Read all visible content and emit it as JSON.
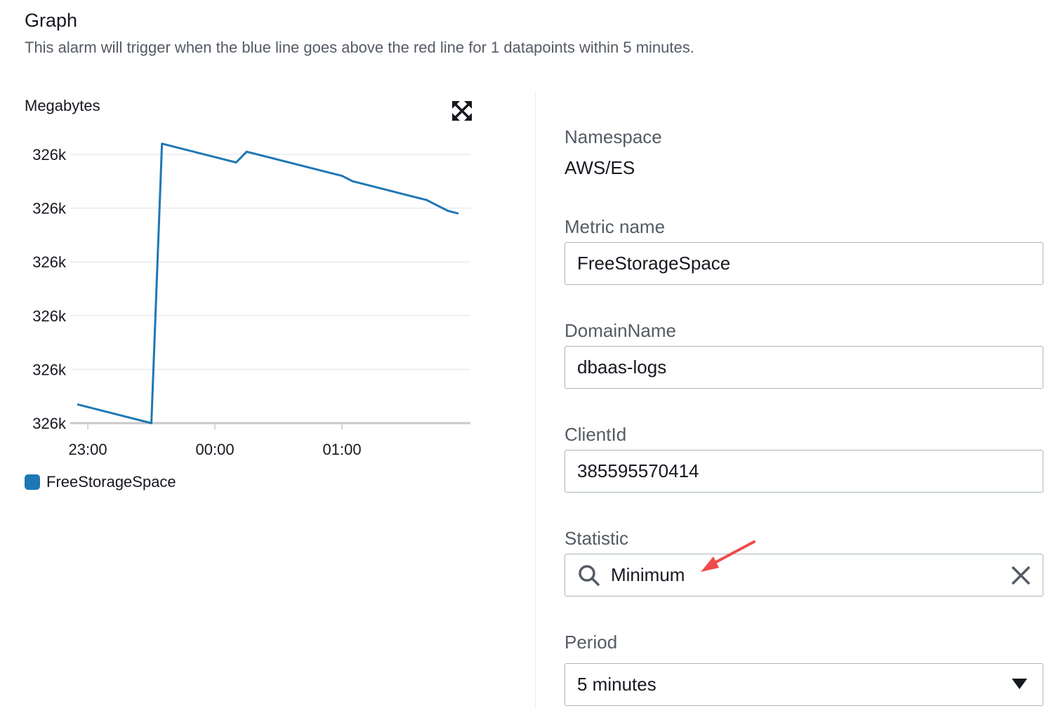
{
  "header": {
    "title": "Graph",
    "description": "This alarm will trigger when the blue line goes above the red line for 1 datapoints within 5 minutes."
  },
  "chart": {
    "unit_label": "Megabytes",
    "expand_icon": "expand-icon",
    "legend_label": "FreeStorageSpace",
    "series_color": "#1f77b4"
  },
  "chart_data": {
    "type": "line",
    "ylabel": "Megabytes",
    "y_tick_labels": [
      "326k",
      "326k",
      "326k",
      "326k",
      "326k",
      "326k"
    ],
    "x_tick_labels": [
      "23:00",
      "00:00",
      "01:00"
    ],
    "x_ticks_minutes": [
      0,
      60,
      120
    ],
    "xlim_minutes": [
      -5,
      175
    ],
    "ylim_relative": [
      0,
      1
    ],
    "grid": true,
    "legend_position": "bottom-left",
    "series": [
      {
        "name": "FreeStorageSpace",
        "color": "#1f77b4",
        "x_minutes": [
          -5,
          30,
          35,
          65,
          70,
          75,
          115,
          120,
          125,
          130,
          155,
          160,
          165,
          170,
          175
        ],
        "y_relative": [
          0.07,
          0.0,
          1.04,
          0.98,
          0.97,
          1.01,
          0.93,
          0.92,
          0.9,
          0.89,
          0.84,
          0.83,
          0.81,
          0.79,
          0.78
        ]
      }
    ]
  },
  "form": {
    "namespace_label": "Namespace",
    "namespace_value": "AWS/ES",
    "metric_name_label": "Metric name",
    "metric_name_value": "FreeStorageSpace",
    "domain_name_label": "DomainName",
    "domain_name_value": "dbaas-logs",
    "client_id_label": "ClientId",
    "client_id_value": "385595570414",
    "statistic_label": "Statistic",
    "statistic_value": "Minimum",
    "period_label": "Period",
    "period_value": "5 minutes"
  },
  "annotation": {
    "arrow_color": "#f04b4b"
  }
}
